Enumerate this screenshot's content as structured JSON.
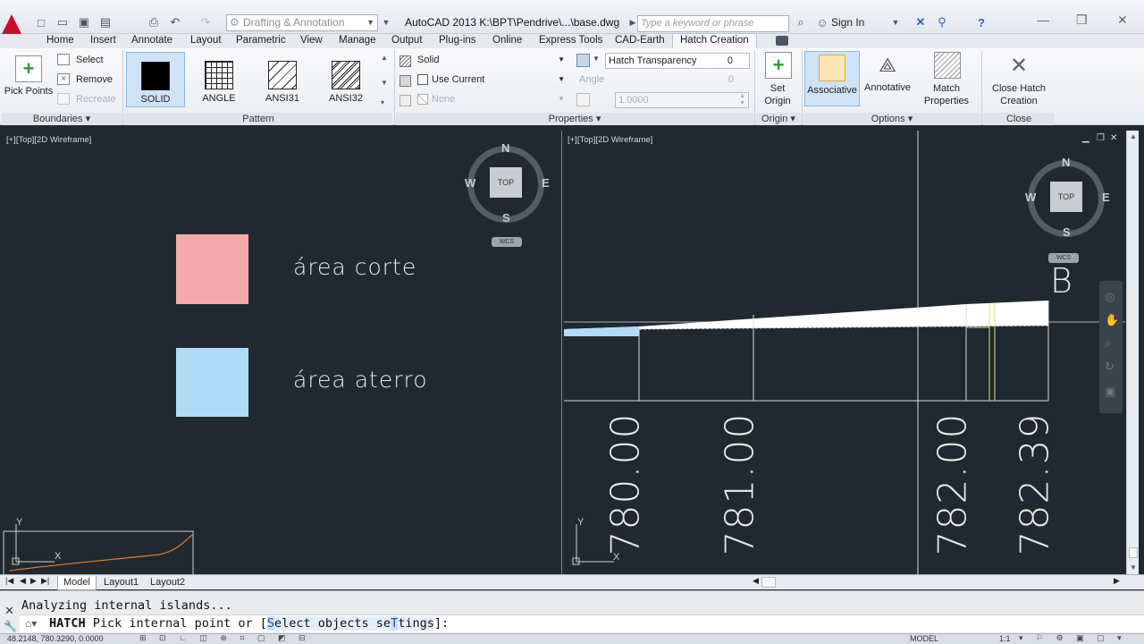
{
  "titlebar": {
    "workspace": "Drafting & Annotation",
    "title": "AutoCAD 2013    K:\\BPT\\Pendrive\\...\\base.dwg",
    "search_placeholder": "Type a keyword or phrase",
    "signin": "Sign In"
  },
  "tabs": [
    "Home",
    "Insert",
    "Annotate",
    "Layout",
    "Parametric",
    "View",
    "Manage",
    "Output",
    "Plug-ins",
    "Online",
    "Express Tools",
    "CAD-Earth",
    "Hatch Creation"
  ],
  "ribbon": {
    "boundaries": {
      "pick_points": "Pick Points",
      "select": "Select",
      "remove": "Remove",
      "recreate": "Recreate",
      "title": "Boundaries"
    },
    "pattern": {
      "items": [
        "SOLID",
        "ANGLE",
        "ANSI31",
        "ANSI32"
      ],
      "selected": "SOLID",
      "title": "Pattern"
    },
    "properties": {
      "type": "Solid",
      "color": "Use Current",
      "background": "None",
      "transparency_label": "Hatch Transparency",
      "transparency_value": "0",
      "angle_label": "Angle",
      "angle_value": "0",
      "scale_value": "1.0000",
      "title": "Properties"
    },
    "origin": {
      "set_origin": "Set Origin",
      "title": "Origin"
    },
    "options": {
      "associative": "Associative",
      "annotative": "Annotative",
      "match_properties": "Match Properties",
      "title": "Options"
    },
    "close": {
      "label": "Close Hatch Creation",
      "title": "Close"
    }
  },
  "viewports": {
    "left": {
      "label": "[+][Top][2D Wireframe]",
      "legend": [
        {
          "text": "área  corte",
          "color": "#f4aaab"
        },
        {
          "text": "área  aterro",
          "color": "#b0dbf7"
        }
      ],
      "compass": {
        "n": "N",
        "s": "S",
        "e": "E",
        "w": "W",
        "top": "TOP",
        "wcs": "WCS"
      },
      "axis": {
        "x": "X",
        "y": "Y"
      }
    },
    "right": {
      "label": "[+][Top][2D Wireframe]",
      "section_letter": "B",
      "elevations": [
        "780.00",
        "781.00",
        "782.00",
        "782.39"
      ],
      "compass": {
        "n": "N",
        "s": "S",
        "e": "E",
        "w": "W",
        "top": "TOP",
        "wcs": "WCS"
      },
      "axis": {
        "x": "X",
        "y": "Y"
      }
    }
  },
  "layout_tabs": [
    "Model",
    "Layout1",
    "Layout2"
  ],
  "command": {
    "history": "Analyzing internal islands...",
    "prompt_cmd": "HATCH",
    "prompt_text": "Pick internal point or [",
    "opt1_hl": "S",
    "opt1_rest": "elect objects ",
    "opt2_a": "se",
    "opt2_hl": "T",
    "opt2_b": "tings",
    "prompt_end": "]:"
  },
  "status": {
    "coords": "48.2148, 780.3290, 0.0000",
    "model": "MODEL",
    "scale": "1:1"
  },
  "colors": {
    "canvas": "#212830",
    "cut": "#f4aaab",
    "fill": "#b0dbf7",
    "ribbon_active": "#cfe3f7"
  }
}
